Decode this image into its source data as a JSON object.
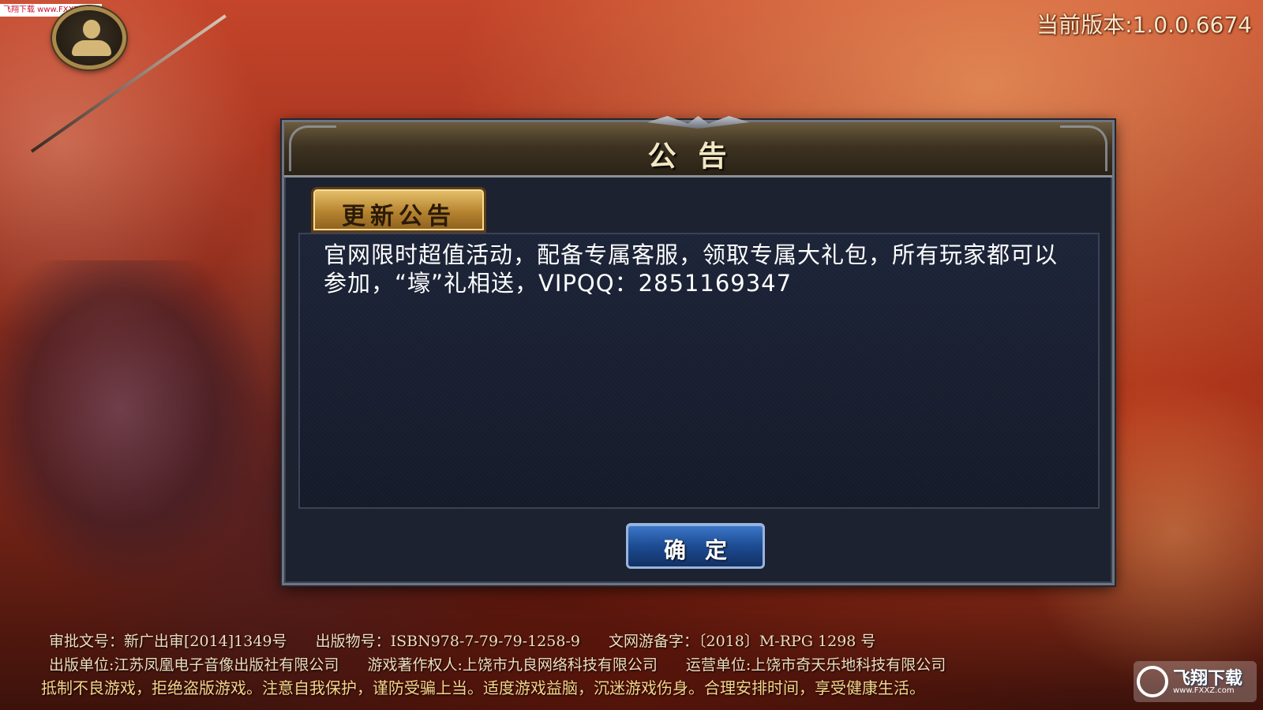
{
  "watermark_top": "飞翔下载 www.FXXZ.com",
  "version": "当前版本:1.0.0.6674",
  "dialog": {
    "title": "公告",
    "tab_label": "更新公告",
    "content": "官网限时超值活动，配备专属客服，领取专属大礼包，所有玩家都可以参加，“壕”礼相送，VIPQQ：2851169347",
    "confirm_label": "确定"
  },
  "footer": {
    "line1": [
      "审批文号：新广出审[2014]1349号",
      "出版物号：ISBN978-7-79-79-1258-9",
      "文网游备字：〔2018〕M-RPG 1298 号"
    ],
    "line2": [
      "出版单位:江苏凤凰电子音像出版社有限公司",
      "游戏著作权人:上饶市九良网络科技有限公司",
      "运营单位:上饶市奇天乐地科技有限公司"
    ],
    "line3": "抵制不良游戏，拒绝盗版游戏。注意自我保护，谨防受骗上当。适度游戏益脑，沉迷游戏伤身。合理安排时间，享受健康生活。"
  },
  "watermark_bottom": {
    "text": "飞翔下载",
    "url": "www.FXXZ.com"
  },
  "icons": {
    "avatar": "user-silhouette-icon"
  },
  "colors": {
    "accent_gold": "#e7c26d",
    "button_blue": "#1d4c93",
    "panel_bg": "#141a29"
  }
}
